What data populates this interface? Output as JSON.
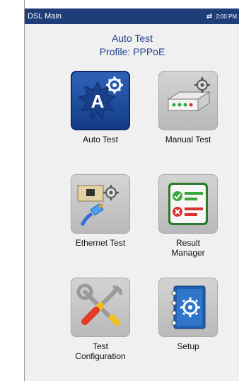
{
  "status_bar": {
    "title": "DSL Main",
    "network_icon": "arrows-icon",
    "time": "2:00 PM"
  },
  "header": {
    "title": "Auto Test",
    "profile": "Profile:  PPPoE"
  },
  "tiles": [
    {
      "label": "Auto Test",
      "icon": "auto-test-icon",
      "selected": true
    },
    {
      "label": "Manual Test",
      "icon": "modem-gear-icon"
    },
    {
      "label": "Ethernet Test",
      "icon": "ethernet-cable-icon"
    },
    {
      "label": "Result",
      "label2": "Manager",
      "icon": "result-manager-icon"
    },
    {
      "label": "Test",
      "label2": "Configuration",
      "icon": "tools-icon"
    },
    {
      "label": "Setup",
      "icon": "setup-notebook-icon"
    }
  ],
  "colors": {
    "statusbar": "#1f3d78",
    "heading": "#1f3d8a",
    "selected_tile": "#1e4a99"
  }
}
